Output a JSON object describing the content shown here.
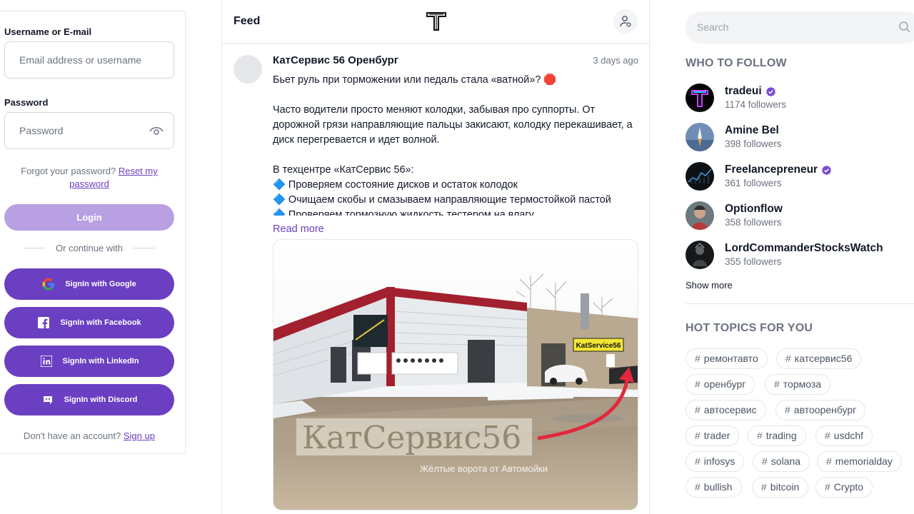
{
  "login": {
    "username_label": "Username or E-mail",
    "username_placeholder": "Email address or username",
    "password_label": "Password",
    "password_placeholder": "Password",
    "forgot_text": "Forgot your password?",
    "reset_link": "Reset my password",
    "login_button": "Login",
    "divider_text": "Or continue with",
    "google": "SignIn with Google",
    "facebook": "SignIn with Facebook",
    "linkedin": "SignIn with LinkedIn",
    "discord": "SignIn with Discord",
    "no_account": "Don't have an account?",
    "signup_link": "Sign up"
  },
  "feed": {
    "title": "Feed",
    "post": {
      "author": "КатСервис 56 Оренбург",
      "time": "3 days ago",
      "body_line1": "Бьет руль при торможении или педаль стала «ватной»? 🛑",
      "body_para2": "Часто водители просто меняют колодки, забывая про суппорты. От дорожной грязи направляющие пальцы закисают, колодку перекашивает, а диск перегревается и идет волной.",
      "body_para3_title": "В техцентре «КатСервис 56»:",
      "bullet1": "🔷 Проверяем состояние дисков и остаток колодок",
      "bullet2": "🔷 Очищаем скобы и смазываем направляющие термостойкой пастой",
      "bullet3": "🔷 Проверяем тормозную жидкость тестером на влагу",
      "read_more": "Read more",
      "image_sign": "KatService56",
      "image_watermark": "КатСервис56",
      "image_caption": "Жёлтые ворота от Автомойки"
    }
  },
  "sidebar": {
    "search_placeholder": "Search",
    "who_to_follow": "WHO TO FOLLOW",
    "follows": [
      {
        "name": "tradeui",
        "followers": "1174 followers",
        "verified": true
      },
      {
        "name": "Amine Bel",
        "followers": "398 followers",
        "verified": false
      },
      {
        "name": "Freelancepreneur",
        "followers": "361 followers",
        "verified": true
      },
      {
        "name": "Optionflow",
        "followers": "358 followers",
        "verified": false
      },
      {
        "name": "LordCommanderStocksWatch",
        "followers": "355 followers",
        "verified": false
      }
    ],
    "show_more": "Show more",
    "hot_topics": "HOT TOPICS FOR YOU",
    "topics": [
      "ремонтавто",
      "катсервис56",
      "оренбург",
      "тормоза",
      "автосервис",
      "автооренбург",
      "trader",
      "trading",
      "usdchf",
      "infosys",
      "solana",
      "memorialday",
      "bullish",
      "bitcoin",
      "Crypto"
    ]
  },
  "colors": {
    "accent": "#6a3fc1",
    "accent_light": "#b9a0e3",
    "verified": "#7c4dce"
  }
}
